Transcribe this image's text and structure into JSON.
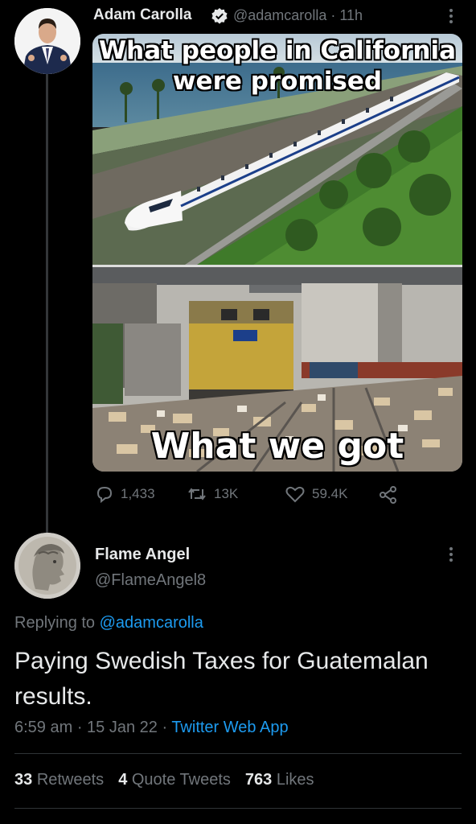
{
  "tweet1": {
    "name": "Adam Carolla",
    "handle_time": "@adamcarolla · 11h",
    "image_caption_top": "What people in California were promised",
    "image_caption_bottom": "What we got",
    "replies": "1,433",
    "retweets": "13K",
    "likes": "59.4K"
  },
  "tweet2": {
    "name": "Flame Angel",
    "handle": "@FlameAngel8",
    "replying_prefix": "Replying to",
    "replying_to": "@adamcarolla",
    "text": "Paying Swedish Taxes for Guatemalan results.",
    "time": "6:59 am · 15 Jan 22 · ",
    "app": "Twitter Web App",
    "stats": {
      "retweets_count": "33",
      "retweets_label": "Retweets",
      "quotes_count": "4",
      "quotes_label": "Quote Tweets",
      "likes_count": "763",
      "likes_label": "Likes"
    }
  },
  "colors": {
    "accent": "#1d9bf0",
    "muted": "#71767b",
    "text": "#e7e9ea",
    "background": "#000000"
  },
  "icons": [
    "verified-icon",
    "more-icon",
    "reply-icon",
    "retweet-icon",
    "like-icon",
    "share-icon"
  ]
}
